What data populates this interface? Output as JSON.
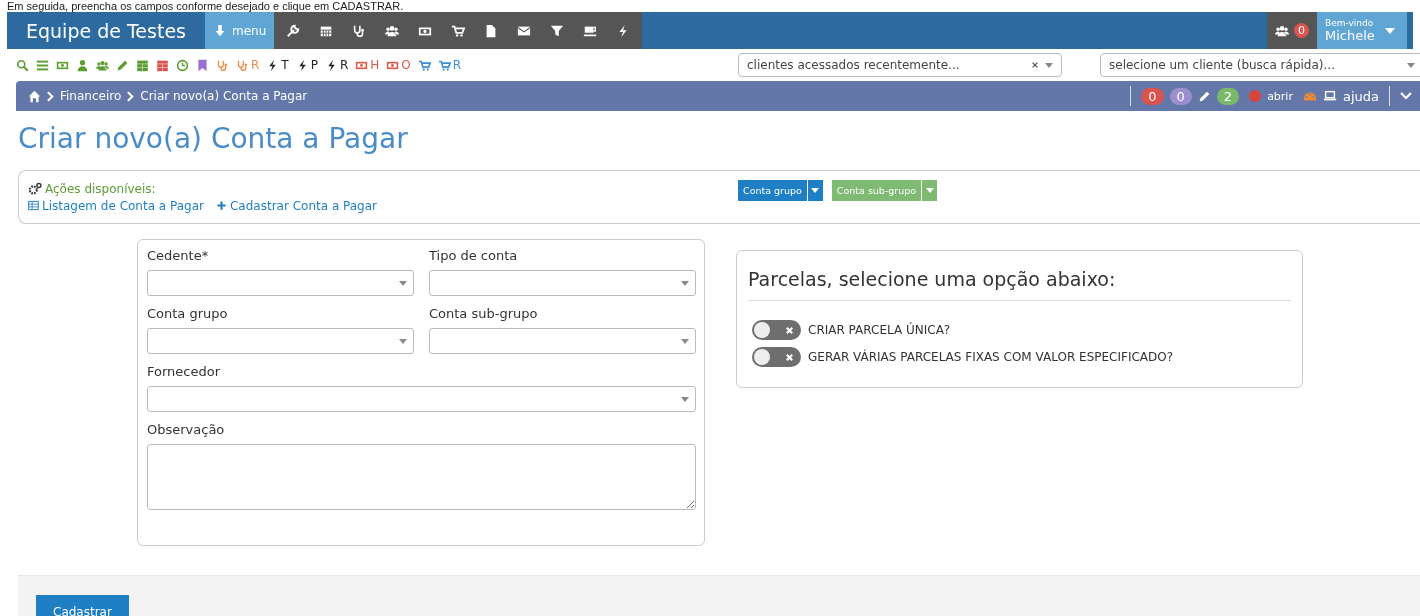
{
  "caption": "Em seguida, preencha os campos conforme desejado e clique em CADASTRAR.",
  "header": {
    "brand": "Equipe de Testes",
    "menu_button": "menu",
    "tools": [
      {
        "kind": "wrench"
      },
      {
        "kind": "calendar"
      },
      {
        "kind": "stethoscope"
      },
      {
        "kind": "users"
      },
      {
        "kind": "money"
      },
      {
        "kind": "cart"
      },
      {
        "kind": "file"
      },
      {
        "kind": "envelope"
      },
      {
        "kind": "filter"
      },
      {
        "kind": "coffee"
      },
      {
        "kind": "bolt"
      }
    ],
    "notifications": "0",
    "welcome": "Bem-vindo",
    "user": "Michele"
  },
  "shortcuts": [
    {
      "kind": "search",
      "color": "#5a9e2f"
    },
    {
      "kind": "list",
      "color": "#5a9e2f"
    },
    {
      "kind": "money",
      "color": "#5a9e2f"
    },
    {
      "kind": "user",
      "color": "#5a9e2f"
    },
    {
      "kind": "users",
      "color": "#5a9e2f"
    },
    {
      "kind": "pencil",
      "color": "#5a9e2f"
    },
    {
      "kind": "calendar",
      "color": "#5a9e2f"
    },
    {
      "kind": "calendar",
      "color": "#d9534f"
    },
    {
      "kind": "clock",
      "color": "#5a9e2f"
    },
    {
      "kind": "bookmark",
      "color": "#9b6fd0"
    },
    {
      "kind": "stethoscope",
      "color": "#f08a4b"
    },
    {
      "kind": "stethoscope",
      "color": "#f08a4b",
      "suffix": "R"
    },
    {
      "kind": "bolt",
      "color": "#222222",
      "suffix": "T"
    },
    {
      "kind": "bolt",
      "color": "#222222",
      "suffix": "P"
    },
    {
      "kind": "bolt",
      "color": "#222222",
      "suffix": "R"
    },
    {
      "kind": "money",
      "color": "#e05a4a",
      "suffix": "H"
    },
    {
      "kind": "money",
      "color": "#e05a4a",
      "suffix": "O"
    },
    {
      "kind": "cart",
      "color": "#3a8fd6"
    },
    {
      "kind": "cart",
      "color": "#3a8fd6",
      "suffix": "R"
    }
  ],
  "recent_clients": {
    "value": "clientes acessados recentemente..."
  },
  "client_search": {
    "placeholder": "selecione um cliente (busca rápida)..."
  },
  "breadcrumb": [
    "Financeiro",
    "Criar novo(a) Conta a Pagar"
  ],
  "badges": [
    {
      "text": "0",
      "color": "#d9534f"
    },
    {
      "text": "0",
      "color": "#9b8fd0"
    },
    {
      "text": "2",
      "color": "#7bb86a"
    }
  ],
  "open_label": "abrir",
  "help_label": "ajuda",
  "page_title": "Criar novo(a) Conta a Pagar",
  "actions": {
    "title": "Ações disponíveis:",
    "links": [
      "Listagem de Conta a Pagar",
      "Cadastrar Conta a Pagar"
    ],
    "buttons": [
      {
        "label": "Conta grupo",
        "color": "#1f7fc4"
      },
      {
        "label": "Conta sub-grupo",
        "color": "#7fba72"
      }
    ]
  },
  "form": {
    "fields": [
      {
        "label": "Cedente*",
        "kind": "select"
      },
      {
        "label": "Tipo de conta",
        "kind": "select"
      },
      {
        "label": "Conta grupo",
        "kind": "select"
      },
      {
        "label": "Conta sub-grupo",
        "kind": "select"
      },
      {
        "label": "Fornecedor",
        "kind": "select-wide"
      },
      {
        "label": "Observação",
        "kind": "textarea"
      }
    ]
  },
  "installments": {
    "title": "Parcelas, selecione uma opção abaixo:",
    "options": [
      {
        "label": "CRIAR PARCELA ÚNICA?",
        "on": false
      },
      {
        "label": "GERAR VÁRIAS PARCELAS FIXAS COM VALOR ESPECIFICADO?",
        "on": false
      }
    ]
  },
  "submit": "Cadastrar"
}
